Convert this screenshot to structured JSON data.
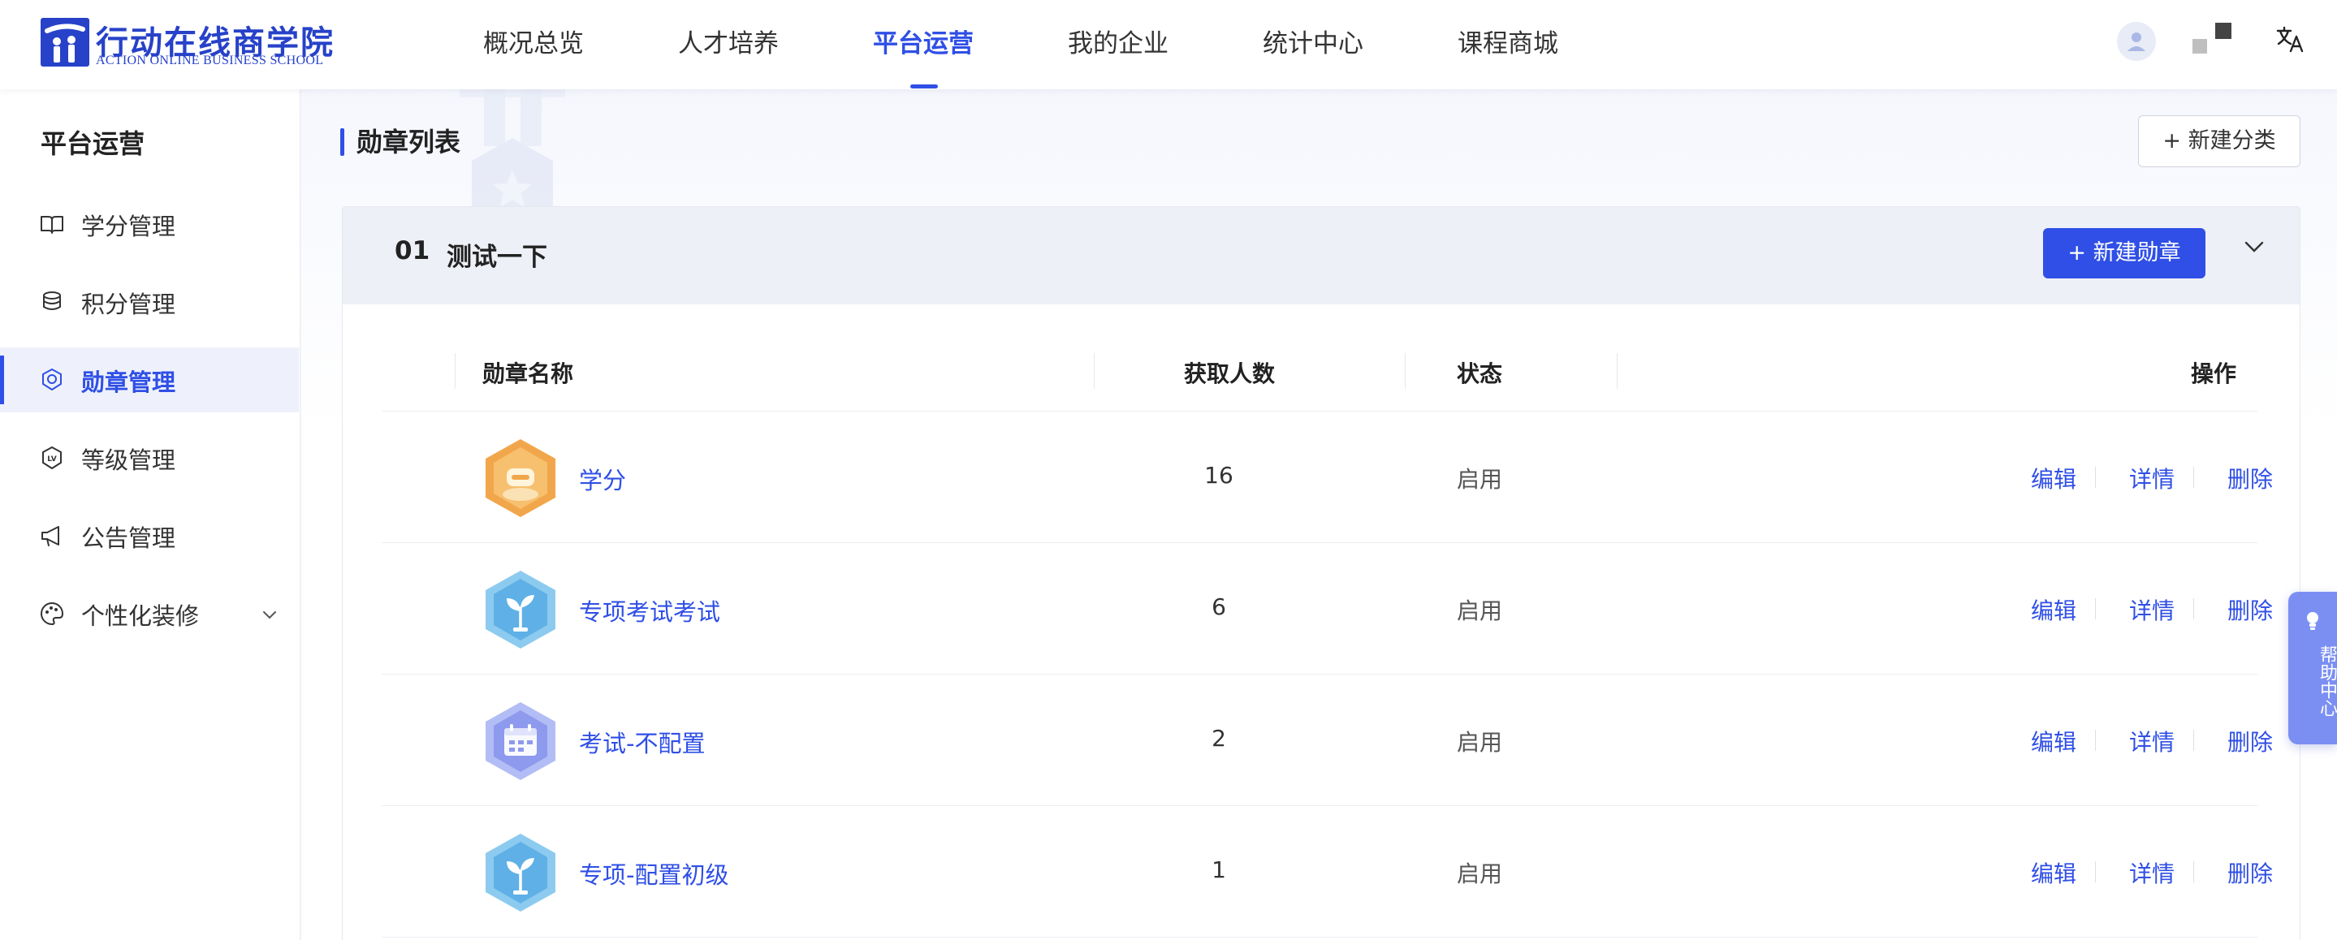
{
  "logo": {
    "cn": "行动在线商学院",
    "en": "ACTION ONLINE BUSINESS SCHOOL"
  },
  "nav": {
    "items": [
      {
        "label": "概况总览",
        "active": false
      },
      {
        "label": "人才培养",
        "active": false
      },
      {
        "label": "平台运营",
        "active": true
      },
      {
        "label": "我的企业",
        "active": false
      },
      {
        "label": "统计中心",
        "active": false
      },
      {
        "label": "课程商城",
        "active": false
      }
    ]
  },
  "top_icons": {
    "avatar": "user-avatar-icon",
    "qr": "qr-code-icon",
    "translate": "translate-icon"
  },
  "sidebar": {
    "title": "平台运营",
    "items": [
      {
        "label": "学分管理",
        "icon": "book-icon",
        "active": false
      },
      {
        "label": "积分管理",
        "icon": "coins-icon",
        "active": false
      },
      {
        "label": "勋章管理",
        "icon": "medal-icon",
        "active": true
      },
      {
        "label": "等级管理",
        "icon": "level-icon",
        "active": false
      },
      {
        "label": "公告管理",
        "icon": "megaphone-icon",
        "active": false
      },
      {
        "label": "个性化装修",
        "icon": "palette-icon",
        "active": false,
        "expandable": true
      }
    ]
  },
  "main": {
    "title": "勋章列表",
    "new_category_label": "+ 新建分类",
    "category": {
      "index": "01",
      "name": "测试一下",
      "new_badge_label": "+ 新建勋章"
    },
    "table": {
      "columns": [
        "勋章名称",
        "获取人数",
        "状态",
        "操作"
      ],
      "rows": [
        {
          "name": "学分",
          "count": "16",
          "status": "启用",
          "badge": "orange-credit-badge"
        },
        {
          "name": "专项考试考试",
          "count": "6",
          "status": "启用",
          "badge": "blue-sprout-badge"
        },
        {
          "name": "考试-不配置",
          "count": "2",
          "status": "启用",
          "badge": "purple-calendar-badge"
        },
        {
          "name": "专项-配置初级",
          "count": "1",
          "status": "启用",
          "badge": "blue-sprout-badge"
        }
      ],
      "actions": {
        "edit": "编辑",
        "detail": "详情",
        "delete": "删除"
      }
    }
  },
  "help": {
    "label": "帮助中心"
  },
  "colors": {
    "accent": "#2f4fe6",
    "brand": "#2742c9",
    "help": "#7b8ff3"
  }
}
